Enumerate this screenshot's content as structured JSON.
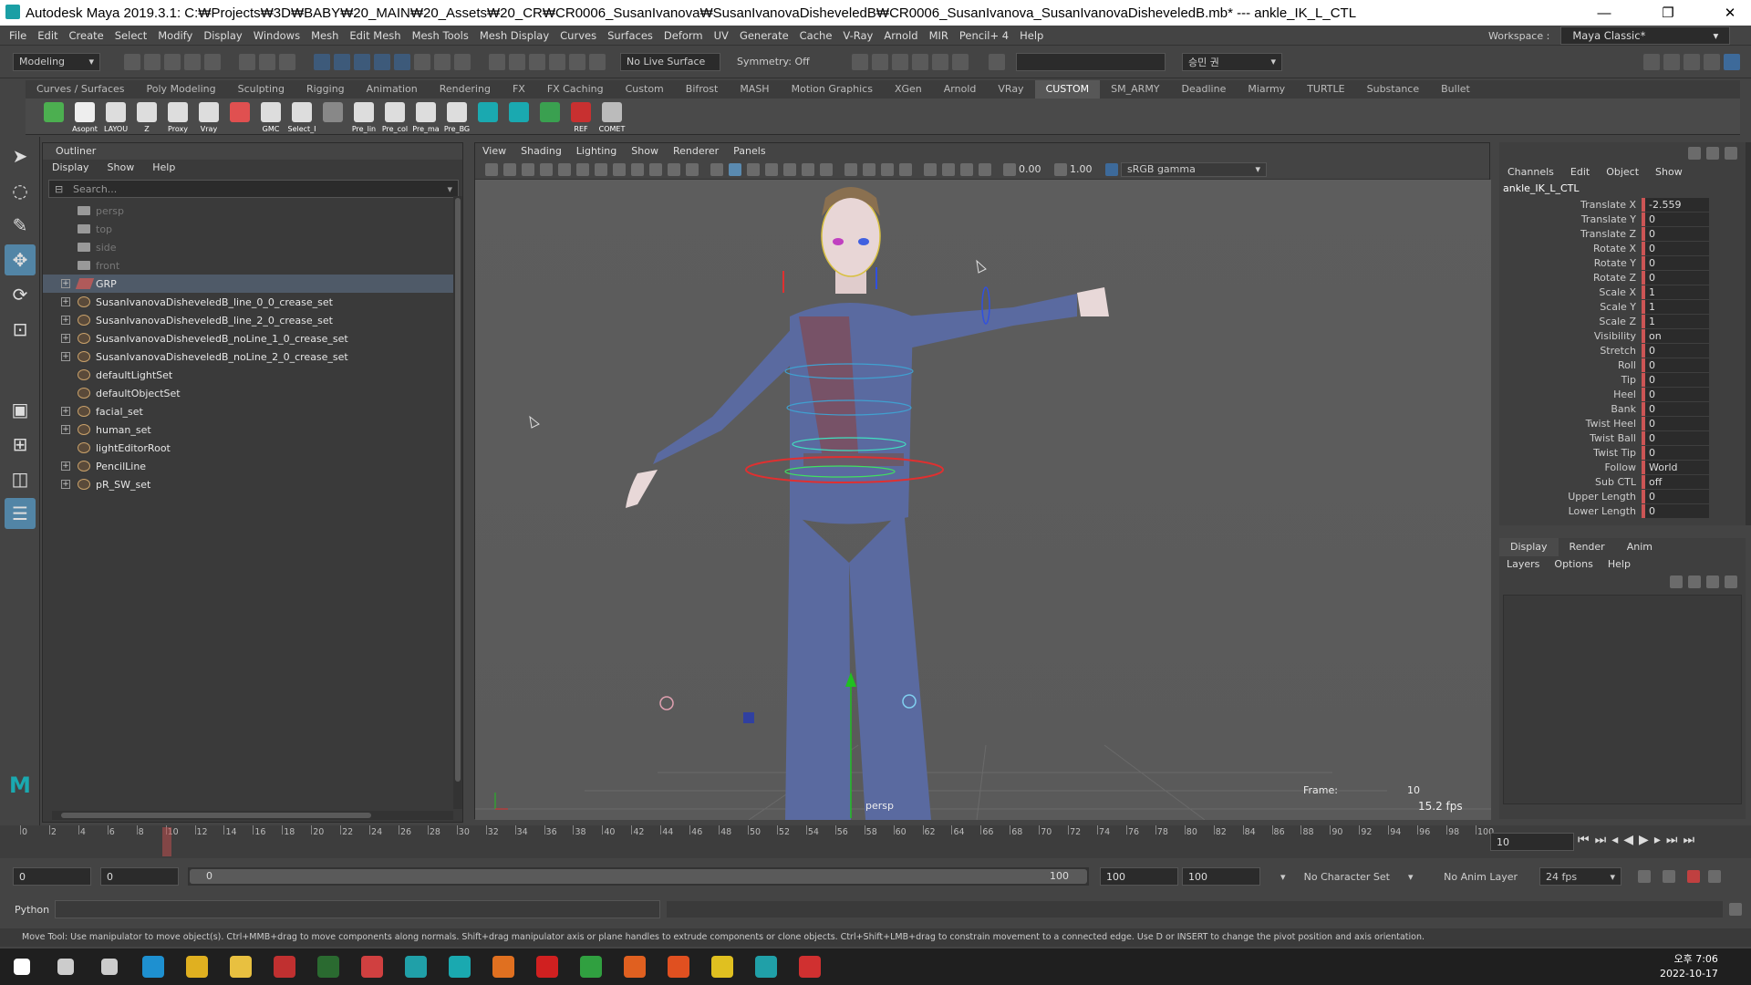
{
  "window": {
    "title": "Autodesk Maya 2019.3.1: C:₩Projects₩3D₩BABY₩20_MAIN₩20_Assets₩20_CR₩CR0006_SusanIvanova₩SusanIvanovaDisheveledB₩CR0006_SusanIvanova_SusanIvanovaDisheveledB.mb*  ---  ankle_IK_L_CTL",
    "minimize": "—",
    "maximize": "❐",
    "close": "✕"
  },
  "menubar": [
    "File",
    "Edit",
    "Create",
    "Select",
    "Modify",
    "Display",
    "Windows",
    "Mesh",
    "Edit Mesh",
    "Mesh Tools",
    "Mesh Display",
    "Curves",
    "Surfaces",
    "Deform",
    "UV",
    "Generate",
    "Cache",
    "V-Ray",
    "Arnold",
    "MIR",
    "Pencil+ 4",
    "Help"
  ],
  "workspace": {
    "label": "Workspace :",
    "value": "Maya Classic*"
  },
  "statusline": {
    "mode": "Modeling",
    "live_surface": "No Live Surface",
    "symmetry": "Symmetry: Off",
    "user": "승민 권"
  },
  "shelf_tabs": [
    "Curves / Surfaces",
    "Poly Modeling",
    "Sculpting",
    "Rigging",
    "Animation",
    "Rendering",
    "FX",
    "FX Caching",
    "Custom",
    "Bifrost",
    "MASH",
    "Motion Graphics",
    "XGen",
    "Arnold",
    "VRay",
    "CUSTOM",
    "SM_ARMY",
    "Deadline",
    "Miarmy",
    "TURTLE",
    "Substance",
    "Bullet"
  ],
  "shelf_active": "CUSTOM",
  "shelf_buttons": [
    {
      "label": "",
      "color": "#4caf50"
    },
    {
      "label": "Asopnt",
      "color": "#eeeeee"
    },
    {
      "label": "LAYOU",
      "color": "#dddddd"
    },
    {
      "label": "Z",
      "color": "#dddddd"
    },
    {
      "label": "Proxy",
      "color": "#dddddd"
    },
    {
      "label": "Vray",
      "color": "#dddddd"
    },
    {
      "label": "",
      "color": "#e05050"
    },
    {
      "label": "GMC",
      "color": "#dddddd"
    },
    {
      "label": "Select_I",
      "color": "#dddddd"
    },
    {
      "label": "",
      "color": "#888888"
    },
    {
      "label": "Pre_lin",
      "color": "#dddddd"
    },
    {
      "label": "Pre_col",
      "color": "#dddddd"
    },
    {
      "label": "Pre_ma",
      "color": "#dddddd"
    },
    {
      "label": "Pre_BG",
      "color": "#dddddd"
    },
    {
      "label": "",
      "color": "#1aa9b0"
    },
    {
      "label": "",
      "color": "#1aa9b0"
    },
    {
      "label": "",
      "color": "#3aa050"
    },
    {
      "label": "REF",
      "color": "#c83030"
    },
    {
      "label": "COMET",
      "color": "#bbbbbb"
    }
  ],
  "outliner": {
    "title": "Outliner",
    "menu": [
      "Display",
      "Show",
      "Help"
    ],
    "search_placeholder": "Search...",
    "items": [
      {
        "label": "persp",
        "type": "cam",
        "dim": true,
        "exp": false
      },
      {
        "label": "top",
        "type": "cam",
        "dim": true,
        "exp": false
      },
      {
        "label": "side",
        "type": "cam",
        "dim": true,
        "exp": false
      },
      {
        "label": "front",
        "type": "cam",
        "dim": true,
        "exp": false
      },
      {
        "label": "GRP",
        "type": "grp",
        "dim": false,
        "exp": true,
        "sel": true
      },
      {
        "label": "SusanIvanovaDisheveledB_line_0_0_crease_set",
        "type": "set",
        "dim": false,
        "exp": true
      },
      {
        "label": "SusanIvanovaDisheveledB_line_2_0_crease_set",
        "type": "set",
        "dim": false,
        "exp": true
      },
      {
        "label": "SusanIvanovaDisheveledB_noLine_1_0_crease_set",
        "type": "set",
        "dim": false,
        "exp": true
      },
      {
        "label": "SusanIvanovaDisheveledB_noLine_2_0_crease_set",
        "type": "set",
        "dim": false,
        "exp": true
      },
      {
        "label": "defaultLightSet",
        "type": "set",
        "dim": false,
        "exp": false
      },
      {
        "label": "defaultObjectSet",
        "type": "set",
        "dim": false,
        "exp": false
      },
      {
        "label": "facial_set",
        "type": "set",
        "dim": false,
        "exp": true
      },
      {
        "label": "human_set",
        "type": "set",
        "dim": false,
        "exp": true
      },
      {
        "label": "lightEditorRoot",
        "type": "set",
        "dim": false,
        "exp": false
      },
      {
        "label": "PencilLine",
        "type": "set",
        "dim": false,
        "exp": true
      },
      {
        "label": "pR_SW_set",
        "type": "set",
        "dim": false,
        "exp": true
      }
    ]
  },
  "viewport": {
    "menu": [
      "View",
      "Shading",
      "Lighting",
      "Show",
      "Renderer",
      "Panels"
    ],
    "exposure": "0.00",
    "gamma": "1.00",
    "colorspace": "sRGB gamma",
    "camera_label": "persp",
    "frame_label": "Frame:",
    "frame_value": "10",
    "fps": "15.2 fps"
  },
  "channelbox": {
    "menu": [
      "Channels",
      "Edit",
      "Object",
      "Show"
    ],
    "node": "ankle_IK_L_CTL",
    "attrs": [
      {
        "name": "Translate X",
        "value": "-2.559"
      },
      {
        "name": "Translate Y",
        "value": "0"
      },
      {
        "name": "Translate Z",
        "value": "0"
      },
      {
        "name": "Rotate X",
        "value": "0"
      },
      {
        "name": "Rotate Y",
        "value": "0"
      },
      {
        "name": "Rotate Z",
        "value": "0"
      },
      {
        "name": "Scale X",
        "value": "1"
      },
      {
        "name": "Scale Y",
        "value": "1"
      },
      {
        "name": "Scale Z",
        "value": "1"
      },
      {
        "name": "Visibility",
        "value": "on"
      },
      {
        "name": "Stretch",
        "value": "0"
      },
      {
        "name": "Roll",
        "value": "0"
      },
      {
        "name": "Tip",
        "value": "0"
      },
      {
        "name": "Heel",
        "value": "0"
      },
      {
        "name": "Bank",
        "value": "0"
      },
      {
        "name": "Twist Heel",
        "value": "0"
      },
      {
        "name": "Twist Ball",
        "value": "0"
      },
      {
        "name": "Twist Tip",
        "value": "0"
      },
      {
        "name": "Follow",
        "value": "World"
      },
      {
        "name": "Sub CTL",
        "value": "off"
      },
      {
        "name": "Upper Length",
        "value": "0"
      },
      {
        "name": "Lower Length",
        "value": "0"
      }
    ]
  },
  "layer_editor": {
    "tabs": [
      "Display",
      "Render",
      "Anim"
    ],
    "menu": [
      "Layers",
      "Options",
      "Help"
    ]
  },
  "timeline": {
    "ticks": [
      "0",
      "2",
      "4",
      "6",
      "8",
      "10",
      "12",
      "14",
      "16",
      "18",
      "20",
      "22",
      "24",
      "26",
      "28",
      "30",
      "32",
      "34",
      "36",
      "38",
      "40",
      "42",
      "44",
      "46",
      "48",
      "50",
      "52",
      "54",
      "56",
      "58",
      "60",
      "62",
      "64",
      "66",
      "68",
      "70",
      "72",
      "74",
      "76",
      "78",
      "80",
      "82",
      "84",
      "86",
      "88",
      "90",
      "92",
      "94",
      "96",
      "98",
      "100"
    ],
    "current_frame": "10",
    "current_frame_field": "10"
  },
  "range": {
    "start": "0",
    "start2": "0",
    "slider_start": "0",
    "slider_end": "100",
    "end": "100",
    "end2": "100",
    "character_set": "No Character Set",
    "anim_layer": "No Anim Layer",
    "fps": "24 fps"
  },
  "cmdline": {
    "label": "Python"
  },
  "helpline": "Move Tool: Use manipulator to move object(s). Ctrl+MMB+drag to move components along normals. Shift+drag manipulator axis or plane handles to extrude components or clone objects. Ctrl+Shift+LMB+drag to constrain movement to a connected edge. Use D or INSERT to change the pivot position and axis orientation.",
  "taskbar": {
    "time": "오후 7:06",
    "date": "2022-10-17",
    "apps": [
      {
        "name": "start",
        "color": "#ffffff"
      },
      {
        "name": "search",
        "color": "#cccccc"
      },
      {
        "name": "task-view",
        "color": "#cccccc"
      },
      {
        "name": "edge",
        "color": "#1e90d0"
      },
      {
        "name": "chrome",
        "color": "#e0b020"
      },
      {
        "name": "explorer",
        "color": "#e8c040"
      },
      {
        "name": "app-red",
        "color": "#c03030"
      },
      {
        "name": "ds",
        "color": "#2a6a30"
      },
      {
        "name": "app-mh",
        "color": "#d04040"
      },
      {
        "name": "app-teal",
        "color": "#20a0a8"
      },
      {
        "name": "maya",
        "color": "#1aa9b0"
      },
      {
        "name": "blender",
        "color": "#e07020"
      },
      {
        "name": "app-play",
        "color": "#d02020"
      },
      {
        "name": "app-green",
        "color": "#30a040"
      },
      {
        "name": "app-m",
        "color": "#e06020"
      },
      {
        "name": "app-orange",
        "color": "#e05020"
      },
      {
        "name": "app-yellow",
        "color": "#e0c020"
      },
      {
        "name": "app-teal2",
        "color": "#20a0a8"
      },
      {
        "name": "app-red2",
        "color": "#d03030"
      }
    ]
  }
}
